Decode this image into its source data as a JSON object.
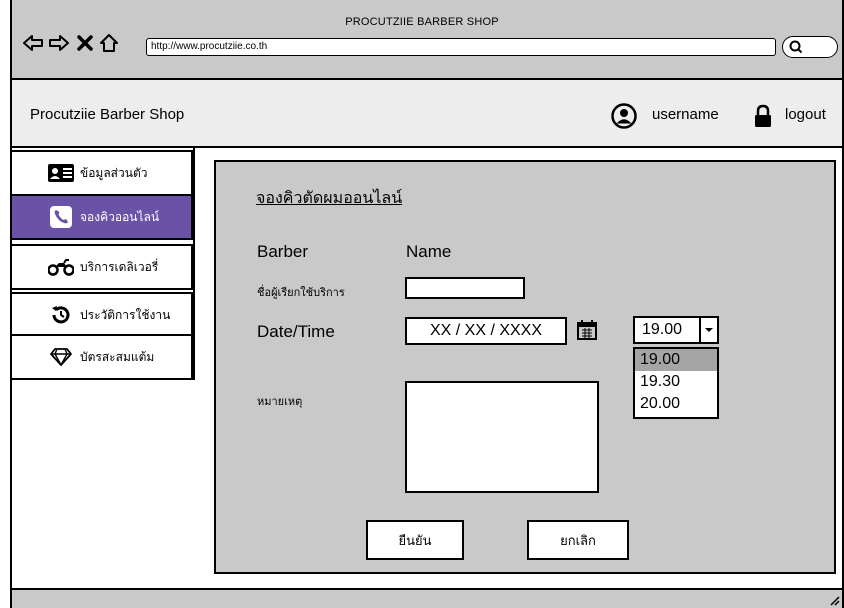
{
  "browser": {
    "window_title": "PROCUTZIIE BARBER SHOP",
    "url": "http://www.procutziie.co.th"
  },
  "header": {
    "brand": "Procutziie Barber Shop",
    "username": "username",
    "logout": "logout"
  },
  "sidebar": {
    "items": [
      {
        "label": "ข้อมูลส่วนตัว",
        "icon": "id-card-icon",
        "active": false
      },
      {
        "label": "จองคิวออนไลน์",
        "icon": "phone-icon",
        "active": true
      },
      {
        "label": "บริการเดลิเวอรี่",
        "icon": "motorcycle-icon",
        "active": false
      },
      {
        "label": "ประวัติการใช้งาน",
        "icon": "history-icon",
        "active": false
      },
      {
        "label": "บัตรสะสมแต้ม",
        "icon": "diamond-icon",
        "active": false
      }
    ]
  },
  "form": {
    "title": "จองคิวตัดผมออนไลน์",
    "barber_label": "Barber",
    "barber_value": "Name",
    "customer_label": "ชื่อผู้เรียกใช้บริการ",
    "customer_value": "",
    "datetime_label": "Date/Time",
    "date_value": "XX / XX / XXXX",
    "time_selected": "19.00",
    "time_options": [
      "19.00",
      "19.30",
      "20.00"
    ],
    "note_label": "หมายเหตุ",
    "note_value": "",
    "confirm_label": "ยืนยัน",
    "cancel_label": "ยกเลิก"
  },
  "colors": {
    "active_sidebar": "#6a52a6",
    "chrome_gray": "#c9c9c9",
    "header_gray": "#ededed",
    "selected_option": "#a5a5a5"
  }
}
